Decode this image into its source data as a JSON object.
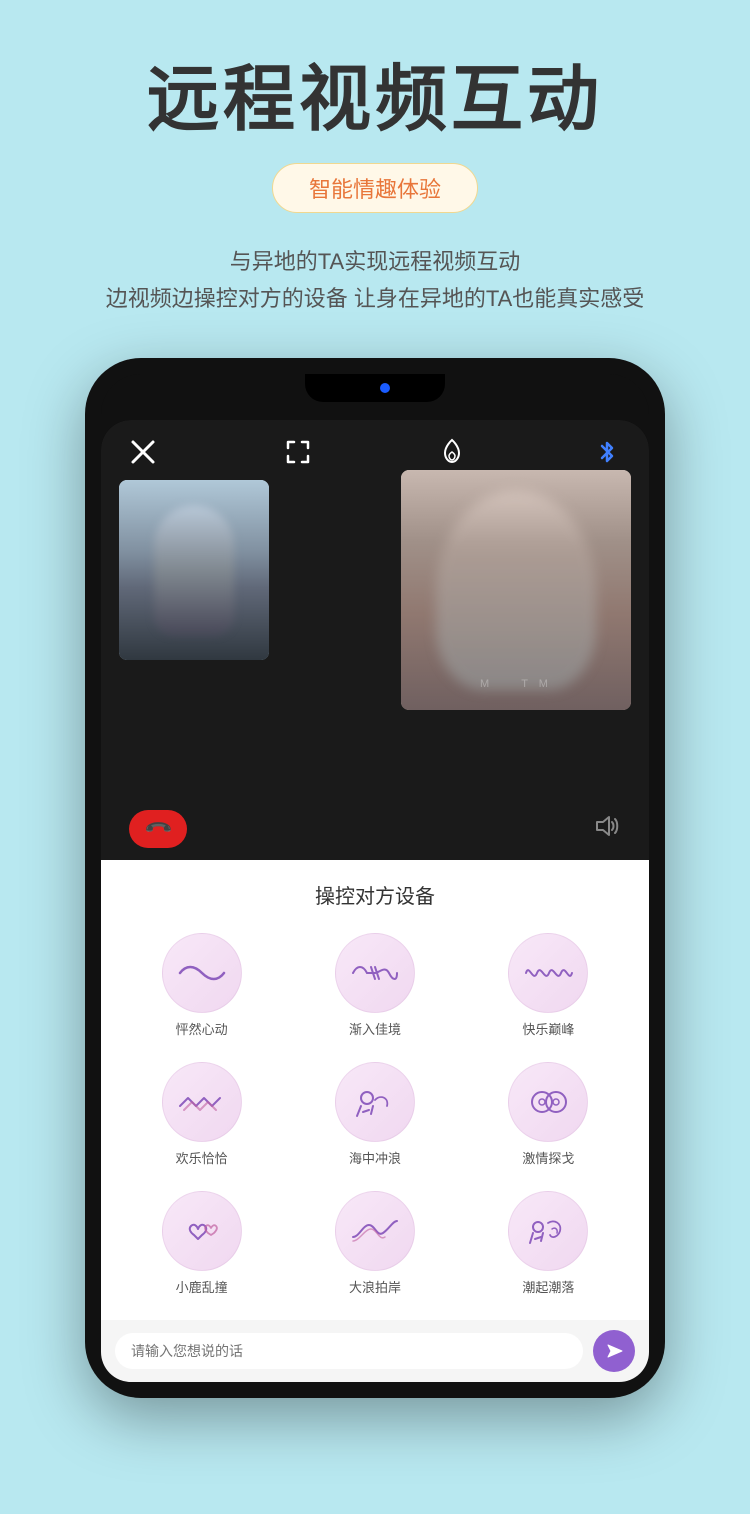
{
  "header": {
    "main_title": "远程视频互动",
    "subtitle": "智能情趣体验",
    "desc_line1": "与异地的TA实现远程视频互动",
    "desc_line2": "边视频边操控对方的设备 让身在异地的TA也能真实感受"
  },
  "phone": {
    "panel_title": "操控对方设备",
    "message_placeholder": "请输入您想说的话",
    "modes": [
      {
        "label": "怦然心动",
        "icon_type": "wave_gentle"
      },
      {
        "label": "渐入佳境",
        "icon_type": "wave_cross"
      },
      {
        "label": "快乐巅峰",
        "icon_type": "wave_intense"
      },
      {
        "label": "欢乐恰恰",
        "icon_type": "wave_zigzag"
      },
      {
        "label": "海中冲浪",
        "icon_type": "wave_swim"
      },
      {
        "label": "激情探戈",
        "icon_type": "wave_infinity"
      },
      {
        "label": "小鹿乱撞",
        "icon_type": "heart_double"
      },
      {
        "label": "大浪拍岸",
        "icon_type": "wave_big"
      },
      {
        "label": "潮起潮落",
        "icon_type": "wave_flow"
      }
    ],
    "colors": {
      "mode_icon": "#9060c0",
      "mode_bg_from": "#fce8fc",
      "mode_bg_to": "#f0d0f0",
      "send_btn": "#9060d0",
      "end_call": "#e02020",
      "bluetooth": "#2060e0"
    }
  }
}
